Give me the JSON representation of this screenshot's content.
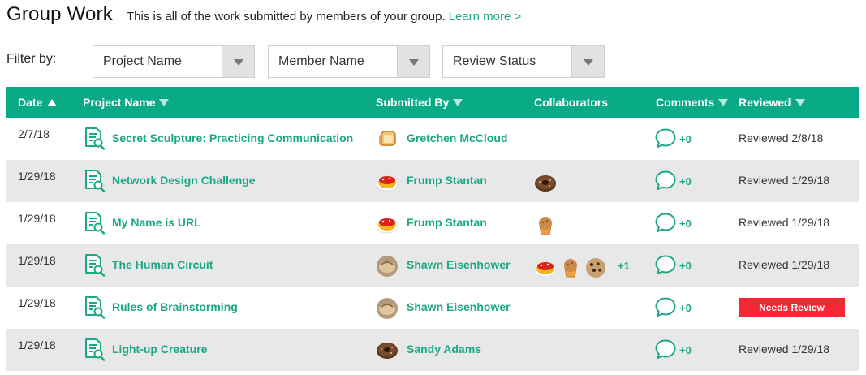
{
  "header": {
    "title": "Group Work",
    "description": "This is all of the work submitted by members of your group.",
    "learn_more": "Learn more >"
  },
  "filters": {
    "label": "Filter by:",
    "selects": [
      {
        "value": "Project Name"
      },
      {
        "value": "Member Name"
      },
      {
        "value": "Review Status"
      }
    ]
  },
  "table": {
    "columns": {
      "date": "Date",
      "project": "Project Name",
      "submitted_by": "Submitted By",
      "collaborators": "Collaborators",
      "comments": "Comments",
      "reviewed": "Reviewed"
    },
    "sort": {
      "column": "Date",
      "direction": "ascending"
    },
    "rows": [
      {
        "date": "2/7/18",
        "project": "Secret Sculpture: Practicing Communication",
        "submitted_by": "Gretchen McCloud",
        "avatar": "toast",
        "collaborators": [],
        "extra_collaborators": "",
        "comments": "+0",
        "reviewed": "Reviewed 2/8/18"
      },
      {
        "date": "1/29/18",
        "project": "Network Design Challenge",
        "submitted_by": "Frump Stantan",
        "avatar": "tart",
        "collaborators": [
          "donut"
        ],
        "extra_collaborators": "",
        "comments": "+0",
        "reviewed": "Reviewed 1/29/18"
      },
      {
        "date": "1/29/18",
        "project": "My Name is URL",
        "submitted_by": "Frump Stantan",
        "avatar": "tart",
        "collaborators": [
          "muffin"
        ],
        "extra_collaborators": "",
        "comments": "+0",
        "reviewed": "Reviewed 1/29/18"
      },
      {
        "date": "1/29/18",
        "project": "The Human Circuit",
        "submitted_by": "Shawn Eisenhower",
        "avatar": "bread",
        "collaborators": [
          "tart",
          "muffin",
          "cookie"
        ],
        "extra_collaborators": "+1",
        "comments": "+0",
        "reviewed": "Reviewed 1/29/18"
      },
      {
        "date": "1/29/18",
        "project": "Rules of Brainstorming",
        "submitted_by": "Shawn Eisenhower",
        "avatar": "bread",
        "collaborators": [],
        "extra_collaborators": "",
        "comments": "+0",
        "reviewed": "Needs Review"
      },
      {
        "date": "1/29/18",
        "project": "Light-up Creature",
        "submitted_by": "Sandy Adams",
        "avatar": "donut",
        "collaborators": [],
        "extra_collaborators": "",
        "comments": "+0",
        "reviewed": "Reviewed 1/29/18"
      }
    ]
  },
  "colors": {
    "accent": "#09ab87",
    "link": "#1aa885",
    "needs_review": "#f42735",
    "row_alt": "#e8e8e8"
  },
  "icons": {
    "document": "document-search-icon",
    "comment": "speech-bubble-icon",
    "avatars": [
      "toast-avatar",
      "tart-avatar",
      "bread-avatar",
      "donut-avatar",
      "muffin-avatar",
      "cookie-avatar"
    ]
  }
}
